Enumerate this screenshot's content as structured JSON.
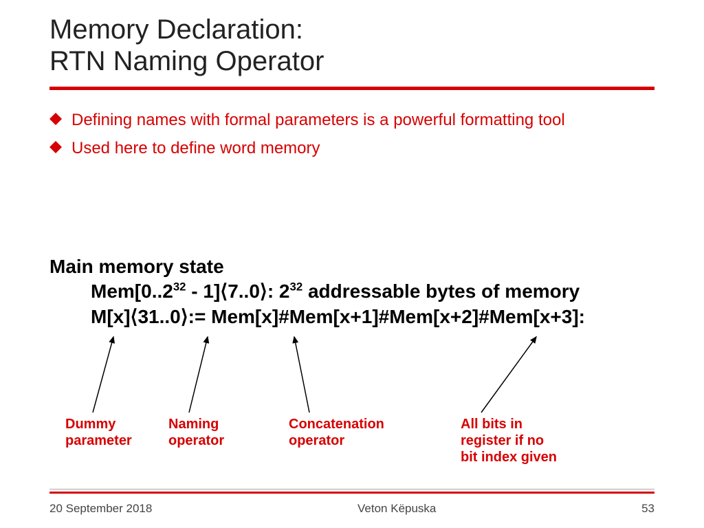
{
  "title": "Memory Declaration:\nRTN Naming Operator",
  "bullets": [
    "Defining names with formal parameters is a powerful formatting tool",
    "Used here to define word memory"
  ],
  "main_state": {
    "heading": "Main memory state",
    "line1_pre": "Mem[0..2",
    "line1_exp1": "32",
    "line1_mid": " - 1]⟨7..0⟩:  2",
    "line1_exp2": "32",
    "line1_post": " addressable bytes of memory",
    "line2": "M[x]⟨31..0⟩:= Mem[x]#Mem[x+1]#Mem[x+2]#Mem[x+3]:"
  },
  "annotations": {
    "dummy": "Dummy\nparameter",
    "naming": "Naming\noperator",
    "concat": "Concatenation\noperator",
    "allbits": "All bits in\nregister if no\nbit index given"
  },
  "footer": {
    "date": "20 September 2018",
    "author": "Veton Këpuska",
    "page": "53"
  }
}
